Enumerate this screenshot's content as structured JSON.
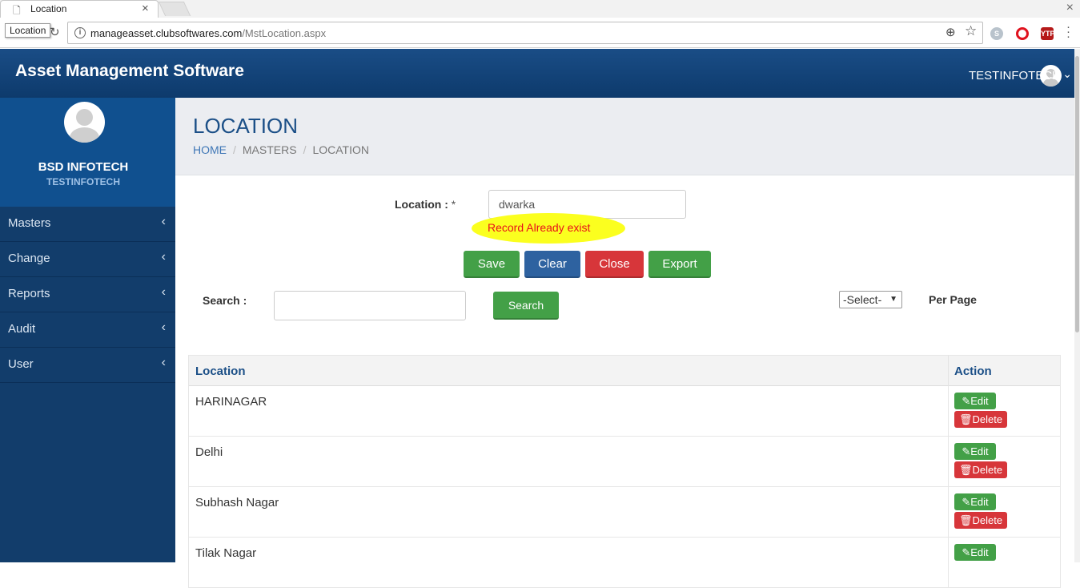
{
  "browser": {
    "tab_title": "Location",
    "tooltip": "Location",
    "url_host": "manageasset.clubsoftwares.com",
    "url_path": "/MstLocation.aspx",
    "ext_ytp": "YTP"
  },
  "header": {
    "app_title": "Asset Management Software",
    "user_name": "TESTINFOTECH"
  },
  "sidebar": {
    "company": "BSD INFOTECH",
    "company_sub": "TESTINFOTECH",
    "items": [
      {
        "label": "Masters"
      },
      {
        "label": "Change"
      },
      {
        "label": "Reports"
      },
      {
        "label": "Audit"
      },
      {
        "label": "User"
      }
    ]
  },
  "page": {
    "title": "LOCATION",
    "breadcrumb": [
      "HOME",
      "MASTERS",
      "LOCATION"
    ]
  },
  "form": {
    "location_label": "Location :",
    "required_mark": "*",
    "location_value": "dwarka",
    "error_message": "Record Already exist",
    "save": "Save",
    "clear": "Clear",
    "close": "Close",
    "export": "Export"
  },
  "search": {
    "label": "Search :",
    "value": "",
    "button": "Search",
    "per_page_selected": "-Select-",
    "per_page_label": "Per Page"
  },
  "table": {
    "headers": [
      "Location",
      "Action"
    ],
    "edit_label": "Edit",
    "delete_label": "Delete",
    "rows": [
      {
        "location": "HARINAGAR"
      },
      {
        "location": "Delhi"
      },
      {
        "location": "Subhash Nagar"
      },
      {
        "location": "Tilak Nagar"
      }
    ]
  },
  "colors": {
    "header_bg": "#123d6b",
    "green": "#43a047",
    "blue": "#2e62a0",
    "red": "#d7363a",
    "error_text": "#e8101a",
    "highlight": "#fbff1f"
  }
}
